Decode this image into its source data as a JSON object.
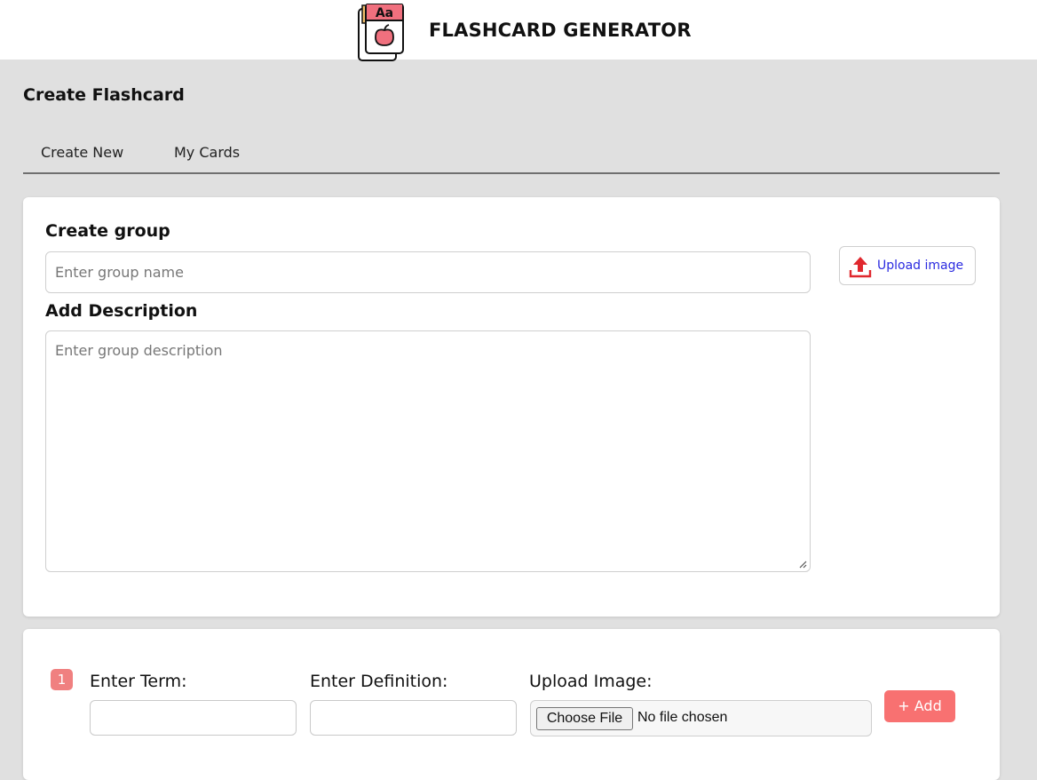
{
  "header": {
    "app_title": "FLASHCARD GENERATOR",
    "logo_icon": "flashcard-apple-icon",
    "logo_text": "Aa"
  },
  "page": {
    "heading": "Create Flashcard"
  },
  "tabs": [
    {
      "label": "Create New"
    },
    {
      "label": "My Cards"
    }
  ],
  "group_form": {
    "group_label": "Create group",
    "group_placeholder": "Enter group name",
    "description_label": "Add Description",
    "description_placeholder": "Enter group description",
    "upload_label": "Upload image",
    "upload_icon": "upload-icon"
  },
  "term_form": {
    "number": "1",
    "term_label": "Enter Term:",
    "definition_label": "Enter Definition:",
    "image_label": "Upload Image:",
    "choose_file_label": "Choose File",
    "file_status": "No file chosen",
    "add_label": "+ Add"
  },
  "colors": {
    "accent": "#f87171",
    "badge": "#f08080",
    "link": "#2a2ae0",
    "upload_icon": "#e0282e",
    "background": "#e0e0e0"
  }
}
